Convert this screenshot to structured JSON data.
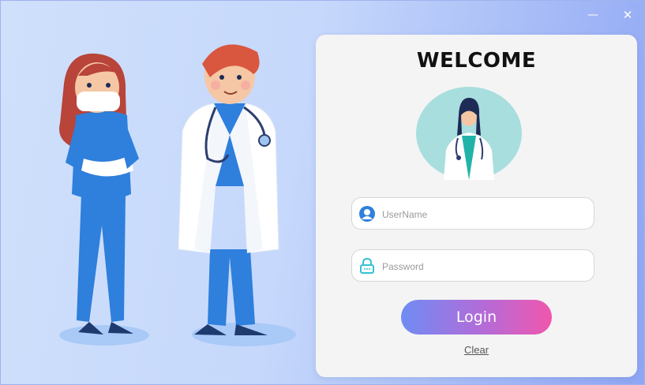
{
  "window": {
    "minimize_glyph": "—",
    "close_glyph": "✕"
  },
  "login": {
    "title": "WELCOME",
    "username_placeholder": "UserName",
    "password_placeholder": "Password",
    "login_label": "Login",
    "clear_label": "Clear"
  },
  "icons": {
    "username": "user-icon",
    "password": "lock-icon"
  },
  "colors": {
    "background_start": "#cfe0fb",
    "background_end": "#8fa6f4",
    "card": "#f4f4f4",
    "button_gradient_start": "#6f8cf3",
    "button_gradient_end": "#f057ad",
    "avatar_circle": "#a8dede",
    "scrubs_blue": "#2f7fdc"
  }
}
